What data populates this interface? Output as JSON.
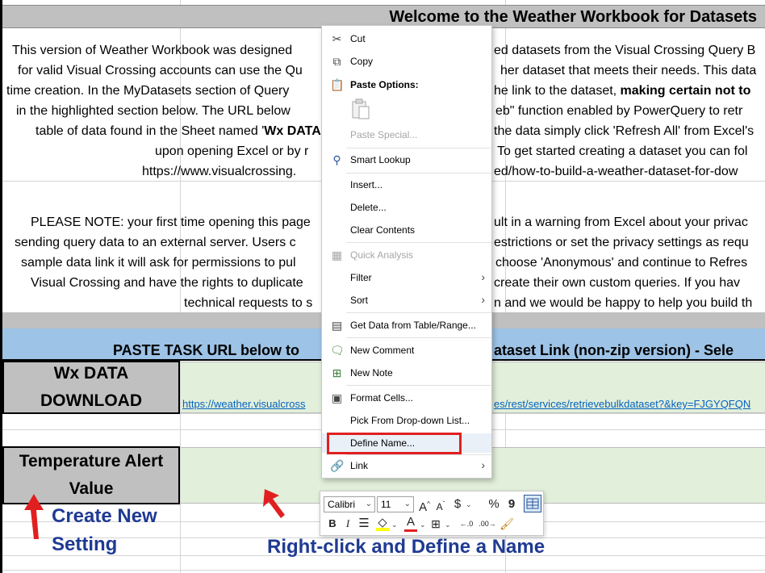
{
  "sheet": {
    "welcome_title": "Welcome to the Weather Workbook for Datasets",
    "paragraph1": [
      "This version of Weather Workbook was designed",
      "ed datasets from the Visual Crossing Query B",
      "for valid Visual Crossing accounts can use the Qu",
      "her dataset that meets their needs.   This data",
      "time creation.   In the MyDatasets section of Query",
      "he link to the dataset, ",
      "making certain not to",
      "in the highlighted section below.   The URL below",
      "eb\" function enabled by PowerQuery to retr",
      "table of data found in the Sheet named '",
      "Wx DATA",
      "the data simply click 'Refresh All' from Excel's",
      "upon opening Excel or by r",
      "To get started creating a dataset you can fol",
      "https://www.visualcrossing.",
      "ed/how-to-build-a-weather-dataset-for-dow"
    ],
    "paragraph2": [
      "PLEASE NOTE: your first time opening this page",
      "ult in a warning from Excel about your privac",
      "sending query data to an external server.  Users c",
      "estrictions or set the privacy settings as requ",
      "sample data link it will ask for permissions to pul",
      "choose 'Anonymous' and continue to Refres",
      "Visual Crossing and have the rights to duplicate",
      "create their own custom queries.   If you hav",
      "technical requests to s",
      "n and we would be happy to help you build th"
    ],
    "paste_band_left": "PASTE TASK URL below to",
    "paste_band_right": "ataset Link (non-zip version) - Sele",
    "wx_label_1": "Wx DATA",
    "wx_label_2": "DOWNLOAD",
    "url_left": "https://weather.visualcross",
    "url_right": "es/rest/services/retrievebulkdataset?&key=FJGYQFQN",
    "temp_label_1": "Temperature Alert",
    "temp_label_2": "Value"
  },
  "annotations": {
    "create_1": "Create New",
    "create_2": "Setting",
    "right_click": "Right-click and Define a Name",
    "arrow_color": "#e02020",
    "text_color": "#1f3a93"
  },
  "context_menu": {
    "cut": "Cut",
    "copy": "Copy",
    "paste_options": "Paste Options:",
    "paste_special": "Paste Special...",
    "smart_lookup": "Smart Lookup",
    "insert": "Insert...",
    "delete": "Delete...",
    "clear_contents": "Clear Contents",
    "quick_analysis": "Quick Analysis",
    "filter": "Filter",
    "sort": "Sort",
    "get_data": "Get Data from Table/Range...",
    "new_comment": "New Comment",
    "new_note": "New Note",
    "format_cells": "Format Cells...",
    "pick_dropdown": "Pick From Drop-down List...",
    "define_name": "Define Name...",
    "link": "Link"
  },
  "mini_toolbar": {
    "font_name": "Calibri",
    "font_size": "11",
    "grow": "A",
    "shrink": "A",
    "currency": "$",
    "percent": "%",
    "comma": "9",
    "bold": "B",
    "italic": "I",
    "font_color_letter": "A"
  }
}
